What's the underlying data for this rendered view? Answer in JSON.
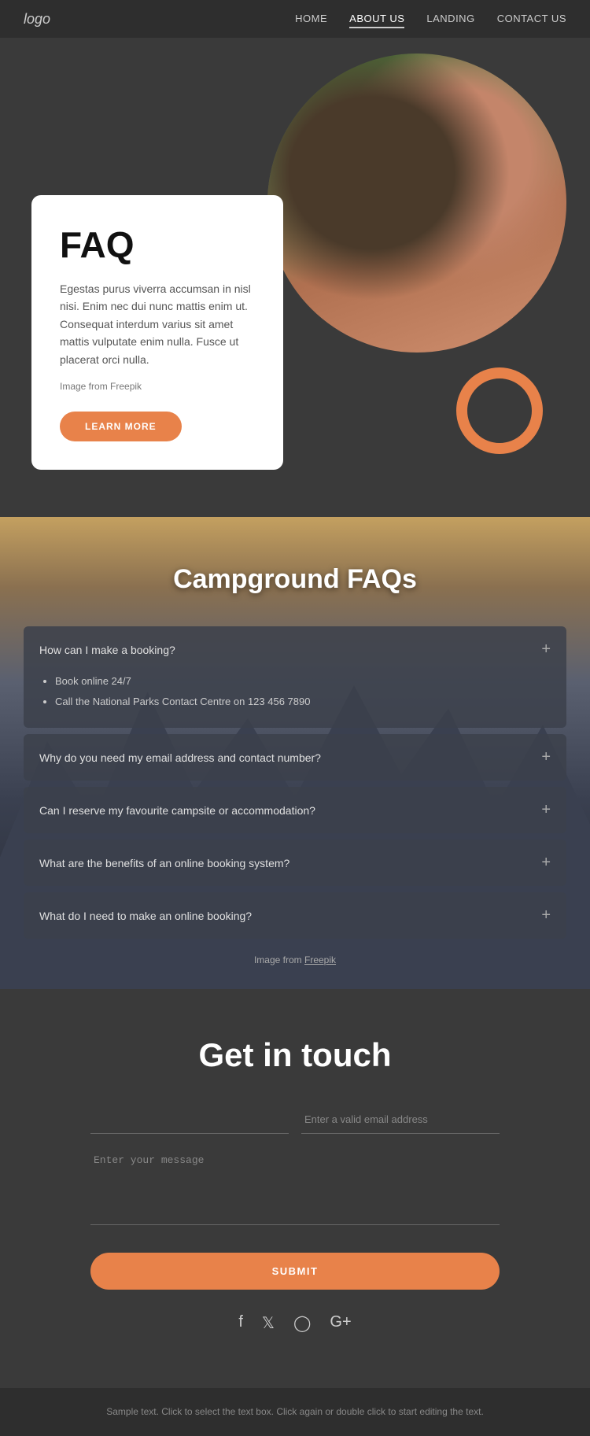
{
  "nav": {
    "logo": "logo",
    "links": [
      {
        "label": "HOME",
        "active": false
      },
      {
        "label": "ABOUT US",
        "active": true
      },
      {
        "label": "LANDING",
        "active": false
      },
      {
        "label": "CONTACT US",
        "active": false
      }
    ]
  },
  "hero": {
    "faq_title": "FAQ",
    "faq_description": "Egestas purus viverra accumsan in nisl nisi. Enim nec dui nunc mattis enim ut. Consequat interdum varius sit amet mattis vulputate enim nulla. Fusce ut placerat orci nulla.",
    "image_credit": "Image from Freepik",
    "learn_more_label": "LEARN MORE"
  },
  "campground": {
    "title": "Campground FAQs",
    "faqs": [
      {
        "question": "How can I make a booking?",
        "answer": "Book online 24/7\nCall the National Parks Contact Centre on 123 456 7890",
        "open": true
      },
      {
        "question": "Why do you need my email address and contact number?",
        "answer": "",
        "open": false
      },
      {
        "question": "Can I reserve my favourite campsite or accommodation?",
        "answer": "",
        "open": false
      },
      {
        "question": "What are the benefits of an online booking system?",
        "answer": "",
        "open": false
      },
      {
        "question": "What do I need to make an online booking?",
        "answer": "",
        "open": false
      }
    ],
    "image_credit": "Image from",
    "image_credit_link": "Freepik"
  },
  "contact": {
    "title": "Get in touch",
    "name_placeholder": "",
    "email_placeholder": "Enter a valid email address",
    "message_placeholder": "Enter your message",
    "submit_label": "SUBMIT",
    "social_icons": [
      "f",
      "t",
      "i",
      "g+"
    ]
  },
  "footer": {
    "text": "Sample text. Click to select the text box. Click again or double\nclick to start editing the text."
  }
}
